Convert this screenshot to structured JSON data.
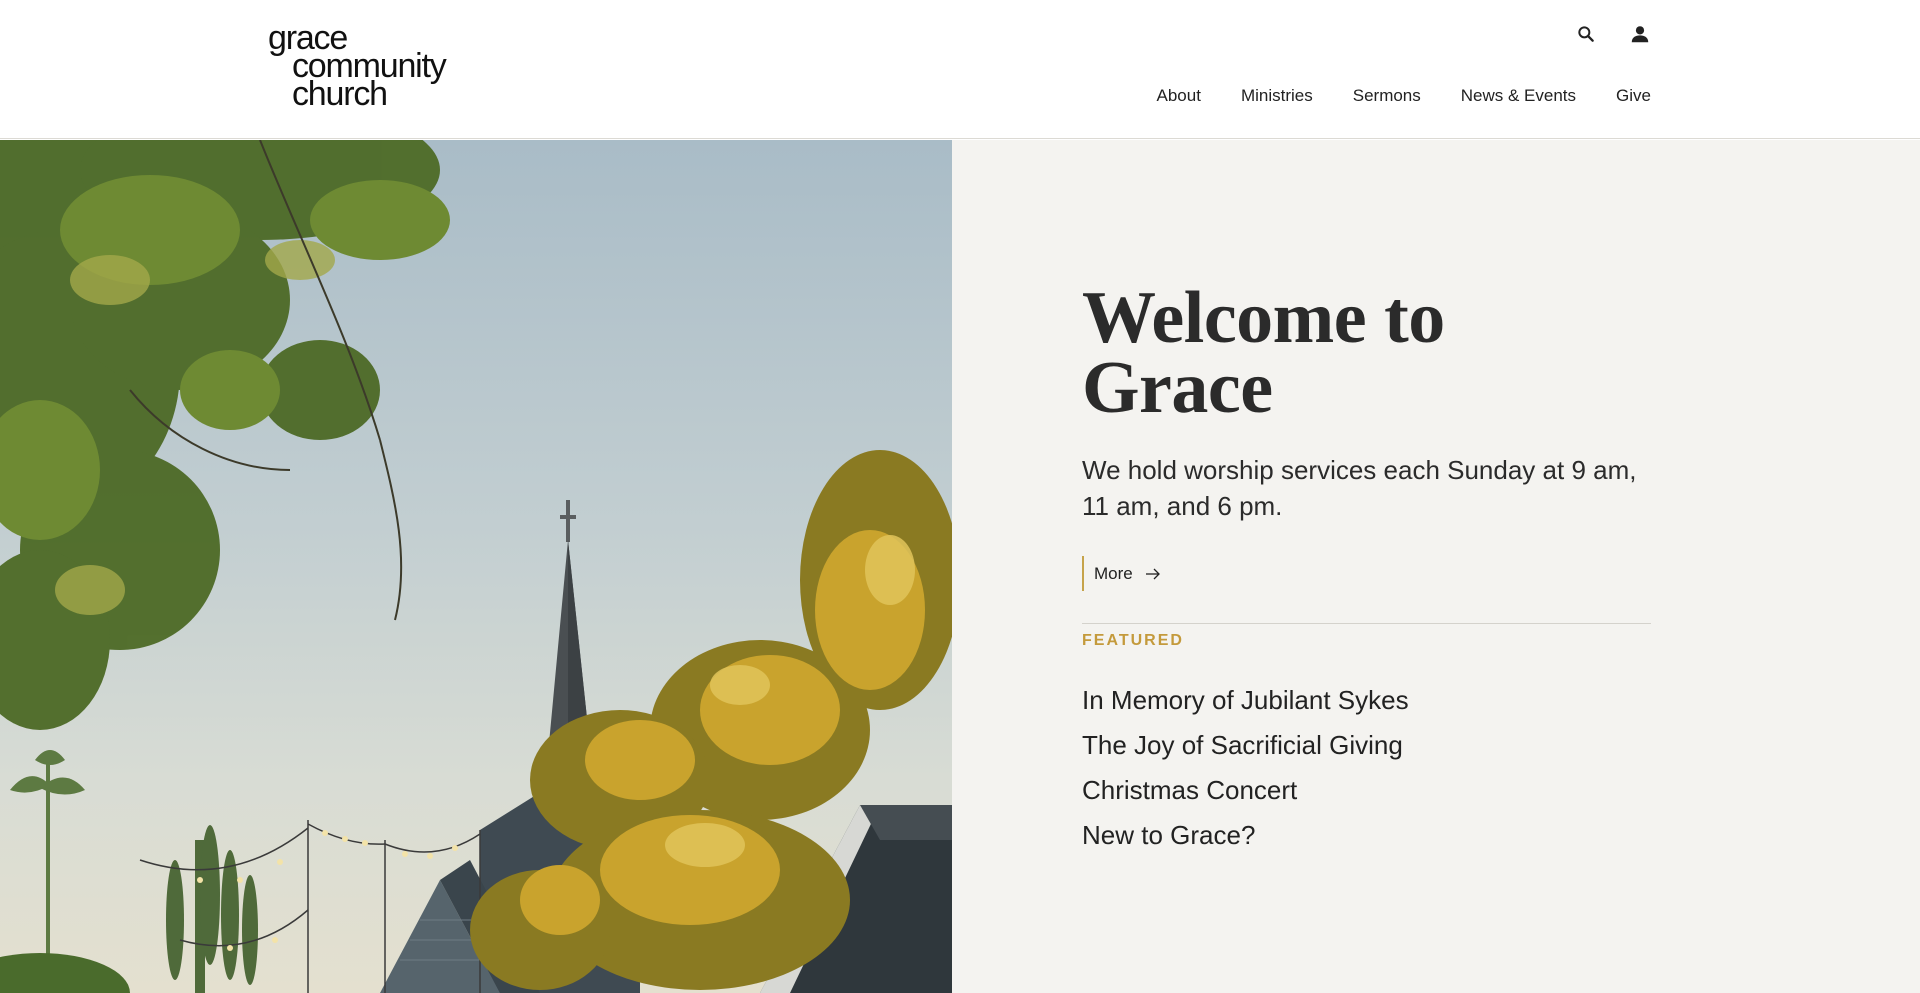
{
  "logo": {
    "line1": "grace",
    "line2": "community",
    "line3": "church"
  },
  "header": {
    "icons": [
      "search-icon",
      "user-icon"
    ]
  },
  "nav": {
    "items": [
      {
        "label": "About"
      },
      {
        "label": "Ministries"
      },
      {
        "label": "Sermons"
      },
      {
        "label": "News & Events"
      },
      {
        "label": "Give"
      }
    ]
  },
  "hero": {
    "title_line1": "Welcome to",
    "title_line2": "Grace",
    "service_text": "We hold worship services each Sunday at 9 am, 11 am, and 6 pm.",
    "more_label": "More",
    "featured_label": "FEATURED",
    "featured_items": [
      {
        "label": "In Memory of Jubilant Sykes"
      },
      {
        "label": "The Joy of Sacrificial Giving"
      },
      {
        "label": "Christmas Concert"
      },
      {
        "label": "New to Grace?"
      }
    ]
  },
  "colors": {
    "accent": "#c49a3c",
    "panel_bg": "#f4f3f0",
    "text": "#222222"
  }
}
